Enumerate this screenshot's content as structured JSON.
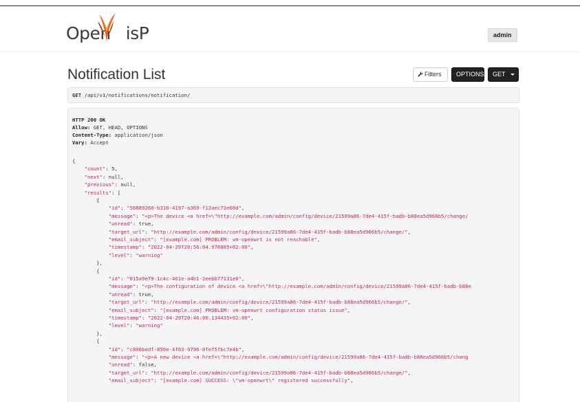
{
  "header": {
    "logo_text_left": "Open",
    "logo_text_right": "isP",
    "user_button": "admin"
  },
  "page": {
    "title": "Notification List"
  },
  "toolbar": {
    "filters_label": "Filters",
    "options_label": "OPTIONS",
    "get_label": "GET"
  },
  "request": {
    "method": "GET",
    "path": "/api/v1/notifications/notification/"
  },
  "response": {
    "headers": [
      {
        "name": "HTTP 200 OK",
        "value": ""
      },
      {
        "name": "Allow:",
        "value": "GET, HEAD, OPTIONS"
      },
      {
        "name": "Content-Type:",
        "value": "application/json"
      },
      {
        "name": "Vary:",
        "value": "Accept"
      }
    ],
    "body_lines": [
      {
        "k": "",
        "v": "{"
      },
      {
        "k": "    \"count\"",
        "v": ": 5,"
      },
      {
        "k": "    \"next\"",
        "v": ": null,"
      },
      {
        "k": "    \"previous\"",
        "v": ": null,"
      },
      {
        "k": "    \"results\"",
        "v": ": ["
      },
      {
        "k": "",
        "v": "        {"
      },
      {
        "k": "            \"id\"",
        "v": ": ",
        "s": "\"56889260-b316-4197-a369-f12aec73e00d\"",
        "t": ","
      },
      {
        "k": "            \"message\"",
        "v": ": ",
        "s": "\"<p>The device <a href=\\\"http://example.com/admin/config/device/21599a86-7de4-415f-badb-b88ea5d966b5/change/",
        "t": ""
      },
      {
        "k": "            \"unread\"",
        "v": ": true,"
      },
      {
        "k": "            \"target_url\"",
        "v": ": ",
        "s": "\"http://example.com/admin/config/device/21599a86-7de4-415f-badb-b88ea5d966b5/change/\"",
        "t": ","
      },
      {
        "k": "            \"email_subject\"",
        "v": ": ",
        "s": "\"[example.com] PROBLEM: vm-openwrt is not reachable\"",
        "t": ","
      },
      {
        "k": "            \"timestamp\"",
        "v": ": ",
        "s": "\"2022-04-29T20:56:04.976805+02:00\"",
        "t": ","
      },
      {
        "k": "            \"level\"",
        "v": ": ",
        "s": "\"warning\"",
        "t": ""
      },
      {
        "k": "",
        "v": "        },"
      },
      {
        "k": "",
        "v": "        {"
      },
      {
        "k": "            \"id\"",
        "v": ": ",
        "s": "\"015a9e79-1c4c-461e-a4b1-2eebb77131e0\"",
        "t": ","
      },
      {
        "k": "            \"message\"",
        "v": ": ",
        "s": "\"<p>The configuration of device <a href=\\\"http://example.com/admin/config/device/21599a86-7de4-415f-badb-b88e",
        "t": ""
      },
      {
        "k": "            \"unread\"",
        "v": ": true,"
      },
      {
        "k": "            \"target_url\"",
        "v": ": ",
        "s": "\"http://example.com/admin/config/device/21599a86-7de4-415f-badb-b88ea5d966b5/change/\"",
        "t": ","
      },
      {
        "k": "            \"email_subject\"",
        "v": ": ",
        "s": "\"[example.com] PROBLEM: vm-openwrt configuration status issue\"",
        "t": ","
      },
      {
        "k": "            \"timestamp\"",
        "v": ": ",
        "s": "\"2022-04-29T20:46:00.134435+02:00\"",
        "t": ","
      },
      {
        "k": "            \"level\"",
        "v": ": ",
        "s": "\"warning\"",
        "t": ""
      },
      {
        "k": "",
        "v": "        },"
      },
      {
        "k": "",
        "v": "        {"
      },
      {
        "k": "            \"id\"",
        "v": ": ",
        "s": "\"c806bedf-850e-4f03-9796-0fef5fbc7e4b\"",
        "t": ","
      },
      {
        "k": "            \"message\"",
        "v": ": ",
        "s": "\"<p>A new device <a href=\\\"http://example.com/admin/config/device/21599a86-7de4-415f-badb-b88ea5d966b5/chang",
        "t": ""
      },
      {
        "k": "            \"unread\"",
        "v": ": false,"
      },
      {
        "k": "            \"target_url\"",
        "v": ": ",
        "s": "\"http://example.com/admin/config/device/21599a86-7de4-415f-badb-b88ea5d966b5/change/\"",
        "t": ","
      },
      {
        "k": "            \"email_subject\"",
        "v": ": ",
        "s": "\"[example.com] SUCCESS: \\\"vm-openwrt\\\" registered successfully\"",
        "t": ","
      }
    ]
  },
  "colors": {
    "json_key": "#c7254e",
    "code_bg": "#f5f5f5",
    "dark_button": "#222222"
  },
  "icons": {
    "filters": "wrench-icon",
    "get_dropdown": "caret-down-icon"
  }
}
